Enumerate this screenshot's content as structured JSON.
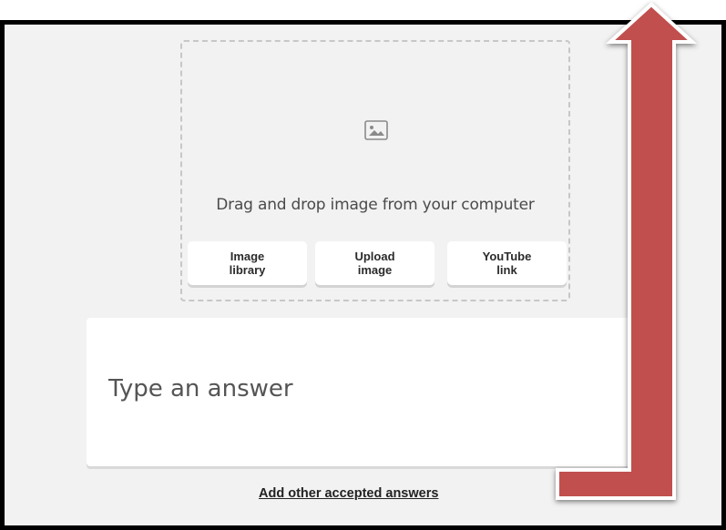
{
  "dropzone": {
    "icon": "image-placeholder-icon",
    "text": "Drag and drop image from your computer",
    "buttons": [
      {
        "label": "Image\nlibrary"
      },
      {
        "label": "Upload\nimage"
      },
      {
        "label": "YouTube\nlink"
      }
    ]
  },
  "answer": {
    "placeholder": "Type an answer",
    "value": ""
  },
  "add_answers_link": "Add other accepted answers",
  "annotation": {
    "icon": "red-arrow-icon",
    "color": "#c0504d"
  },
  "colors": {
    "background": "#f2f2f2",
    "frame": "#000000"
  }
}
